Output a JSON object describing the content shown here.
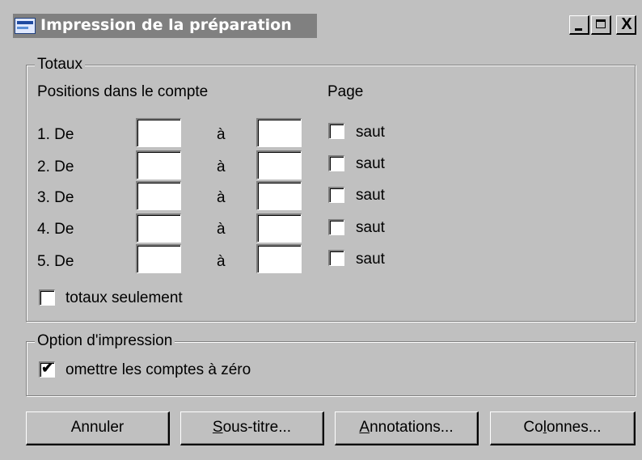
{
  "window": {
    "title": "Impression de la préparation",
    "controls": {
      "minimize": "_",
      "maximize": "□",
      "close": "X"
    }
  },
  "totaux": {
    "legend": "Totaux",
    "positions_header": "Positions dans le compte",
    "page_header": "Page",
    "rows": [
      {
        "label": "1.  De",
        "to_label": "à",
        "from_value": "",
        "to_value": "",
        "saut_label": "saut",
        "saut_checked": false
      },
      {
        "label": "2.  De",
        "to_label": "à",
        "from_value": "",
        "to_value": "",
        "saut_label": "saut",
        "saut_checked": false
      },
      {
        "label": "3.  De",
        "to_label": "à",
        "from_value": "",
        "to_value": "",
        "saut_label": "saut",
        "saut_checked": false
      },
      {
        "label": "4.  De",
        "to_label": "à",
        "from_value": "",
        "to_value": "",
        "saut_label": "saut",
        "saut_checked": false
      },
      {
        "label": "5.  De",
        "to_label": "à",
        "from_value": "",
        "to_value": "",
        "saut_label": "saut",
        "saut_checked": false
      }
    ],
    "totaux_seulement_label": "totaux seulement",
    "totaux_seulement_checked": false
  },
  "option": {
    "legend": "Option d'impression",
    "omettre_label": "omettre les comptes à zéro",
    "omettre_checked": true
  },
  "buttons": {
    "annuler": "Annuler",
    "sous_titre": {
      "accel": "S",
      "rest": "ous-titre..."
    },
    "annotations": {
      "accel": "A",
      "rest": "nnotations..."
    },
    "colonnes": {
      "pre": "Co",
      "accel": "l",
      "rest": "onnes..."
    }
  },
  "icons": {
    "app": "app-icon",
    "checkmark": "✔"
  }
}
